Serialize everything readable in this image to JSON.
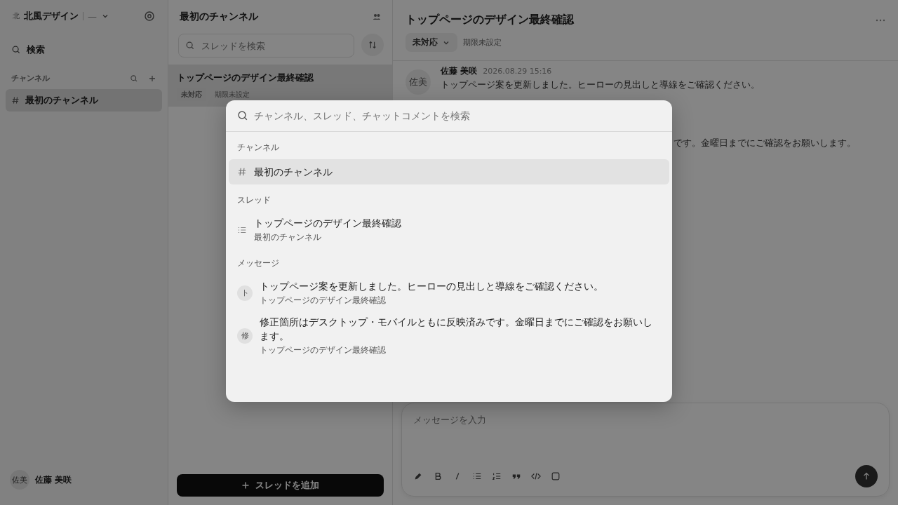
{
  "sidebar": {
    "workspace": {
      "avatar": "北",
      "name": "北風デザイン",
      "extra": "—"
    },
    "search_label": "検索",
    "section_title": "チャンネル",
    "channels": [
      {
        "name": "最初のチャンネル",
        "selected": true
      }
    ],
    "user": {
      "avatar": "佐美",
      "name": "佐藤 美咲"
    }
  },
  "thread_list": {
    "title": "最初のチャンネル",
    "search_placeholder": "スレッドを検索",
    "threads": [
      {
        "title": "トップページのデザイン最終確認",
        "tags": [
          "未対応",
          "期限未設定"
        ],
        "selected": true
      }
    ],
    "add_button": "スレッドを追加"
  },
  "thread": {
    "title": "トップページのデザイン最終確認",
    "status": "未対応",
    "deadline": "期限未設定",
    "messages": [
      {
        "kind": "full",
        "avatar": "佐美",
        "author": "佐藤 美咲",
        "time": "2026.08.29 15:16",
        "text": "トップページ案を更新しました。ヒーローの見出しと導線をご確認ください。"
      },
      {
        "kind": "fragment",
        "text": "です。金曜日までにご確認をお願いします。"
      }
    ],
    "composer": {
      "placeholder": "メッセージを入力"
    }
  },
  "search_dialog": {
    "placeholder": "チャンネル、スレッド、チャットコメントを検索",
    "groups": [
      {
        "kind": "channel",
        "title": "チャンネル",
        "items": [
          {
            "title": "最初のチャンネル",
            "selected": true
          }
        ]
      },
      {
        "kind": "thread",
        "title": "スレッド",
        "items": [
          {
            "title": "トップページのデザイン最終確認",
            "subtitle": "最初のチャンネル",
            "selected": false
          }
        ]
      },
      {
        "kind": "message",
        "title": "メッセージ",
        "items": [
          {
            "avatar": "ト",
            "title": "トップページ案を更新しました。ヒーローの見出しと導線をご確認ください。",
            "subtitle": "トップページのデザイン最終確認",
            "selected": false
          },
          {
            "avatar": "修",
            "title": "修正箇所はデスクトップ・モバイルともに反映済みです。金曜日までにご確認をお願いします。",
            "subtitle": "トップページのデザイン最終確認",
            "selected": false
          }
        ]
      }
    ]
  }
}
